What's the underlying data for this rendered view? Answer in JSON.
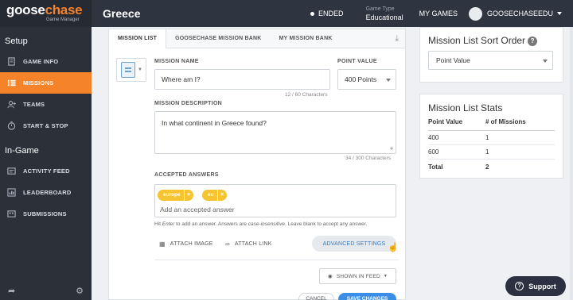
{
  "app": {
    "logo_goose": "goose",
    "logo_chase": "chase",
    "logo_sub": "Game Manager",
    "game_title": "Greece",
    "status": "ENDED",
    "game_type_label": "Game Type",
    "game_type_value": "Educational",
    "my_games": "MY GAMES",
    "username": "GOOSECHASEEDU"
  },
  "sidebar": {
    "setup_heading": "Setup",
    "ingame_heading": "In-Game",
    "setup_items": [
      {
        "label": "GAME INFO",
        "icon": "document-icon"
      },
      {
        "label": "MISSIONS",
        "icon": "list-icon"
      },
      {
        "label": "TEAMS",
        "icon": "team-icon"
      },
      {
        "label": "START & STOP",
        "icon": "clock-icon"
      }
    ],
    "ingame_items": [
      {
        "label": "ACTIVITY FEED",
        "icon": "feed-icon"
      },
      {
        "label": "LEADERBOARD",
        "icon": "chart-icon"
      },
      {
        "label": "SUBMISSIONS",
        "icon": "photos-icon"
      }
    ],
    "active_item": "MISSIONS"
  },
  "tabs": {
    "items": [
      "MISSION LIST",
      "GOOSECHASE MISSION BANK",
      "MY MISSION BANK"
    ],
    "active": "MISSION LIST"
  },
  "form": {
    "mission_name_label": "MISSION NAME",
    "mission_name_value": "Where am I?",
    "mission_name_counter": "12 / 60 Characters",
    "point_value_label": "POINT VALUE",
    "point_value_value": "400 Points",
    "description_label": "MISSION DESCRIPTION",
    "description_value": "In what continent in Greece found?",
    "description_counter": "34 / 300 Characters",
    "answers_label": "ACCEPTED ANSWERS",
    "answers": [
      "europe",
      "eu"
    ],
    "answer_remove_glyph": "×",
    "answer_placeholder": "Add an accepted answer",
    "hint_pre": "Hit ",
    "hint_key": "Enter",
    "hint_mid": " to add an answer. Answers are ",
    "hint_em": "case-insensitive",
    "hint_post": ". Leave blank to accept any answer.",
    "attach_image": "ATTACH IMAGE",
    "attach_link": "ATTACH LINK",
    "advanced_settings": "ADVANCED SETTINGS",
    "shown_in_feed": "SHOWN IN FEED",
    "cancel": "CANCEL",
    "save": "SAVE CHANGES"
  },
  "sort_panel": {
    "title": "Mission List Sort Order",
    "help_glyph": "?",
    "selected": "Point Value"
  },
  "stats_panel": {
    "title": "Mission List Stats",
    "headers": [
      "Point Value",
      "# of Missions"
    ],
    "rows": [
      [
        "400",
        "1"
      ],
      [
        "600",
        "1"
      ]
    ],
    "total_label": "Total",
    "total_value": "2"
  },
  "support": {
    "label": "Support",
    "glyph": "?"
  },
  "colors": {
    "accent": "#f5832a",
    "sidebar": "#2b3039",
    "topbar": "#2e3440",
    "chip": "#f6c431",
    "link": "#3579c1",
    "primary": "#3b8ee8"
  }
}
